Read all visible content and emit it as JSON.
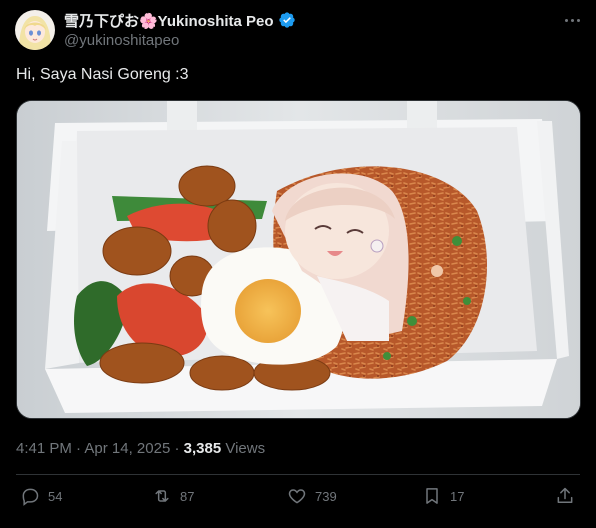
{
  "author": {
    "display_name": "雪乃下ぴお🌸Yukinoshita Peo",
    "handle": "@yukinoshitapeo",
    "verified_icon": "verified-badge-icon",
    "accent": "#1d9bf0"
  },
  "tweet": {
    "text": "Hi, Saya Nasi Goreng :3",
    "time": "4:41 PM",
    "date": "Apr 14, 2025",
    "views_count": "3,385",
    "views_label": "Views"
  },
  "actions": {
    "replies": "54",
    "reposts": "87",
    "likes": "739",
    "bookmarks": "17"
  },
  "icons": [
    "more-icon",
    "reply-icon",
    "repost-icon",
    "like-icon",
    "bookmark-icon",
    "share-icon"
  ]
}
